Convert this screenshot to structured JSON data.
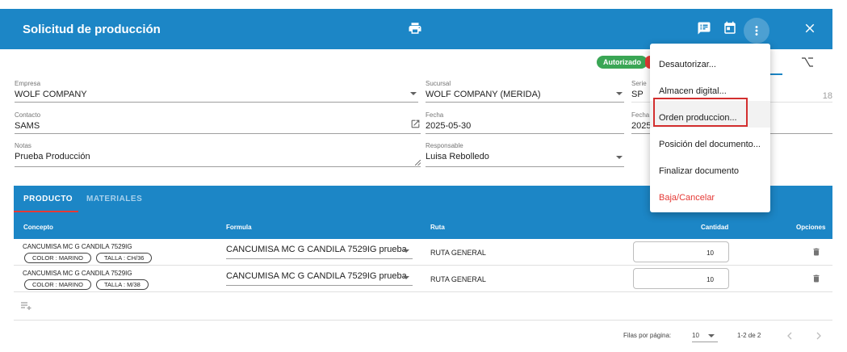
{
  "header": {
    "title": "Solicitud de producción",
    "accent_color": "#1c86c6"
  },
  "status": {
    "authorized_label": "Autorizado"
  },
  "form": {
    "empresa": {
      "label": "Empresa",
      "value": "WOLF COMPANY"
    },
    "sucursal": {
      "label": "Sucursal",
      "value": "WOLF COMPANY (MERIDA)"
    },
    "serie": {
      "label": "Serie",
      "value": "SP",
      "folio": "18"
    },
    "contacto": {
      "label": "Contacto",
      "value": "SAMS"
    },
    "fecha": {
      "label": "Fecha",
      "value": "2025-05-30"
    },
    "fecha2": {
      "label": "Fecha",
      "value": "2025"
    },
    "notas": {
      "label": "Notas",
      "value": "Prueba Producción"
    },
    "responsable": {
      "label": "Responsable",
      "value": "Luisa Rebolledo"
    }
  },
  "tabs": [
    {
      "label": "PRODUCTO"
    },
    {
      "label": "MATERIALES"
    }
  ],
  "table": {
    "columns": [
      "Concepto",
      "Formula",
      "Ruta",
      "Cantidad",
      "Opciones"
    ],
    "rows": [
      {
        "concepto": "CANCUMISA MC G CANDILA 7529IG",
        "chip1": "COLOR : MARINO",
        "chip2": "TALLA : CH/36",
        "formula": "CANCUMISA MC G CANDILA 7529IG prueba",
        "ruta": "RUTA GENERAL",
        "cantidad": "10"
      },
      {
        "concepto": "CANCUMISA MC G CANDILA 7529IG",
        "chip1": "COLOR : MARINO",
        "chip2": "TALLA : M/38",
        "formula": "CANCUMISA MC G CANDILA 7529IG prueba",
        "ruta": "RUTA GENERAL",
        "cantidad": "10"
      }
    ]
  },
  "pagination": {
    "rows_per_page_label": "Filas por página:",
    "rows_per_page": "10",
    "range": "1-2 de 2"
  },
  "menu": {
    "items": [
      {
        "label": "Desautorizar..."
      },
      {
        "label": "Almacen digital..."
      },
      {
        "label": "Orden produccion..."
      },
      {
        "label": "Posición del documento..."
      },
      {
        "label": "Finalizar documento"
      },
      {
        "label": "Baja/Cancelar"
      }
    ]
  },
  "icons": {
    "print": "print-icon",
    "note": "note-icon",
    "calendar": "calendar-icon",
    "more": "more-vert-icon",
    "close": "close-icon",
    "branch": "branch-icon",
    "edit": "open-edit-icon",
    "delete": "trash-icon",
    "add_row": "playlist-add-icon",
    "chevron_left": "chevron-left-icon",
    "chevron_right": "chevron-right-icon"
  }
}
